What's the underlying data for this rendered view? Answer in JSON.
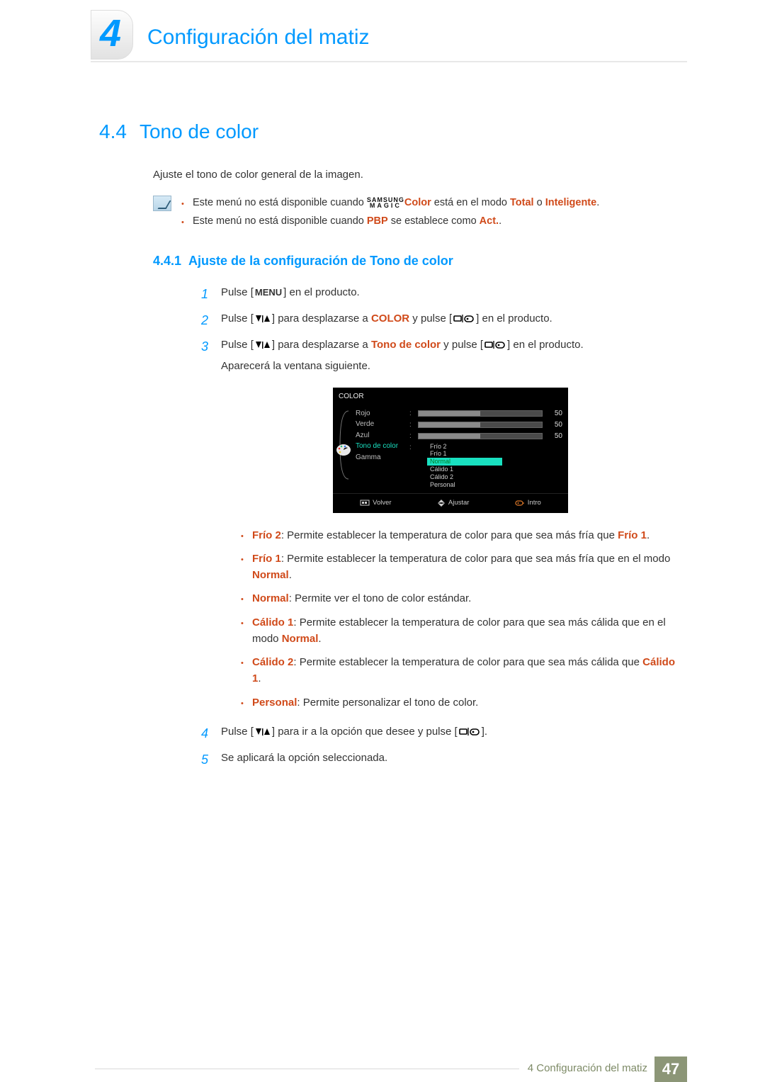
{
  "chapter": {
    "number": "4",
    "title": "Configuración del matiz"
  },
  "section": {
    "number": "4.4",
    "title": "Tono de color"
  },
  "intro": "Ajuste el tono de color general de la imagen.",
  "magic": {
    "line1": "SAMSUNG",
    "line2": "MAGIC"
  },
  "notes": {
    "n1_pre": "Este menú no está disponible cuando ",
    "n1_color": "Color",
    "n1_mid": " está en el modo ",
    "n1_total": "Total",
    "n1_or": " o ",
    "n1_int": "Inteligente",
    "n1_end": ".",
    "n2_pre": "Este menú no está disponible cuando ",
    "n2_pbp": "PBP",
    "n2_mid": " se establece como ",
    "n2_act": "Act.",
    "n2_end": "."
  },
  "subsection": {
    "number": "4.4.1",
    "title": "Ajuste de la configuración de Tono de color"
  },
  "steps": {
    "s1": {
      "num": "1",
      "pre": "Pulse [",
      "btn": "MENU",
      "post": "] en el producto."
    },
    "s2": {
      "num": "2",
      "pre": "Pulse [",
      "mid1": "] para desplazarse a ",
      "target": "COLOR",
      "mid2": " y pulse [",
      "post": "] en el producto."
    },
    "s3": {
      "num": "3",
      "pre": "Pulse [",
      "mid1": "] para desplazarse a ",
      "target": "Tono de color",
      "mid2": " y pulse [",
      "post": "] en el producto.",
      "sub": "Aparecerá la ventana siguiente."
    },
    "s4": {
      "num": "4",
      "pre": "Pulse [",
      "mid": "] para ir a la opción que desee y pulse [",
      "post": "]."
    },
    "s5": {
      "num": "5",
      "text": "Se aplicará la opción seleccionada."
    }
  },
  "osd": {
    "title": "COLOR",
    "items": [
      "Rojo",
      "Verde",
      "Azul",
      "Tono de color",
      "Gamma"
    ],
    "selected_index": 3,
    "sliders": [
      {
        "value": 50,
        "pct": 50
      },
      {
        "value": 50,
        "pct": 50
      },
      {
        "value": 50,
        "pct": 50
      }
    ],
    "options": [
      "Frío 2",
      "Frío 1",
      "Normal",
      "Cálido 1",
      "Cálido 2",
      "Personal"
    ],
    "option_hi_index": 2,
    "footer": {
      "back": "Volver",
      "adjust": "Ajustar",
      "enter": "Intro"
    }
  },
  "defs": {
    "d1": {
      "term": "Frío 2",
      "pre": ": Permite establecer la temperatura de color para que sea más fría que ",
      "ref": "Frío 1",
      "end": "."
    },
    "d2": {
      "term": "Frío 1",
      "pre": ": Permite establecer la temperatura de color para que sea más fría que en el modo ",
      "ref": "Normal",
      "end": "."
    },
    "d3": {
      "term": "Normal",
      "text": ": Permite ver el tono de color estándar."
    },
    "d4": {
      "term": "Cálido 1",
      "pre": ": Permite establecer la temperatura de color para que sea más cálida que en el modo ",
      "ref": "Normal",
      "end": "."
    },
    "d5": {
      "term": "Cálido 2",
      "pre": ": Permite establecer la temperatura de color para que sea más cálida que ",
      "ref": "Cálido 1",
      "end": "."
    },
    "d6": {
      "term": "Personal",
      "text": ": Permite personalizar el tono de color."
    }
  },
  "footer": {
    "chapter_ref": "4 Configuración del matiz",
    "page": "47"
  }
}
